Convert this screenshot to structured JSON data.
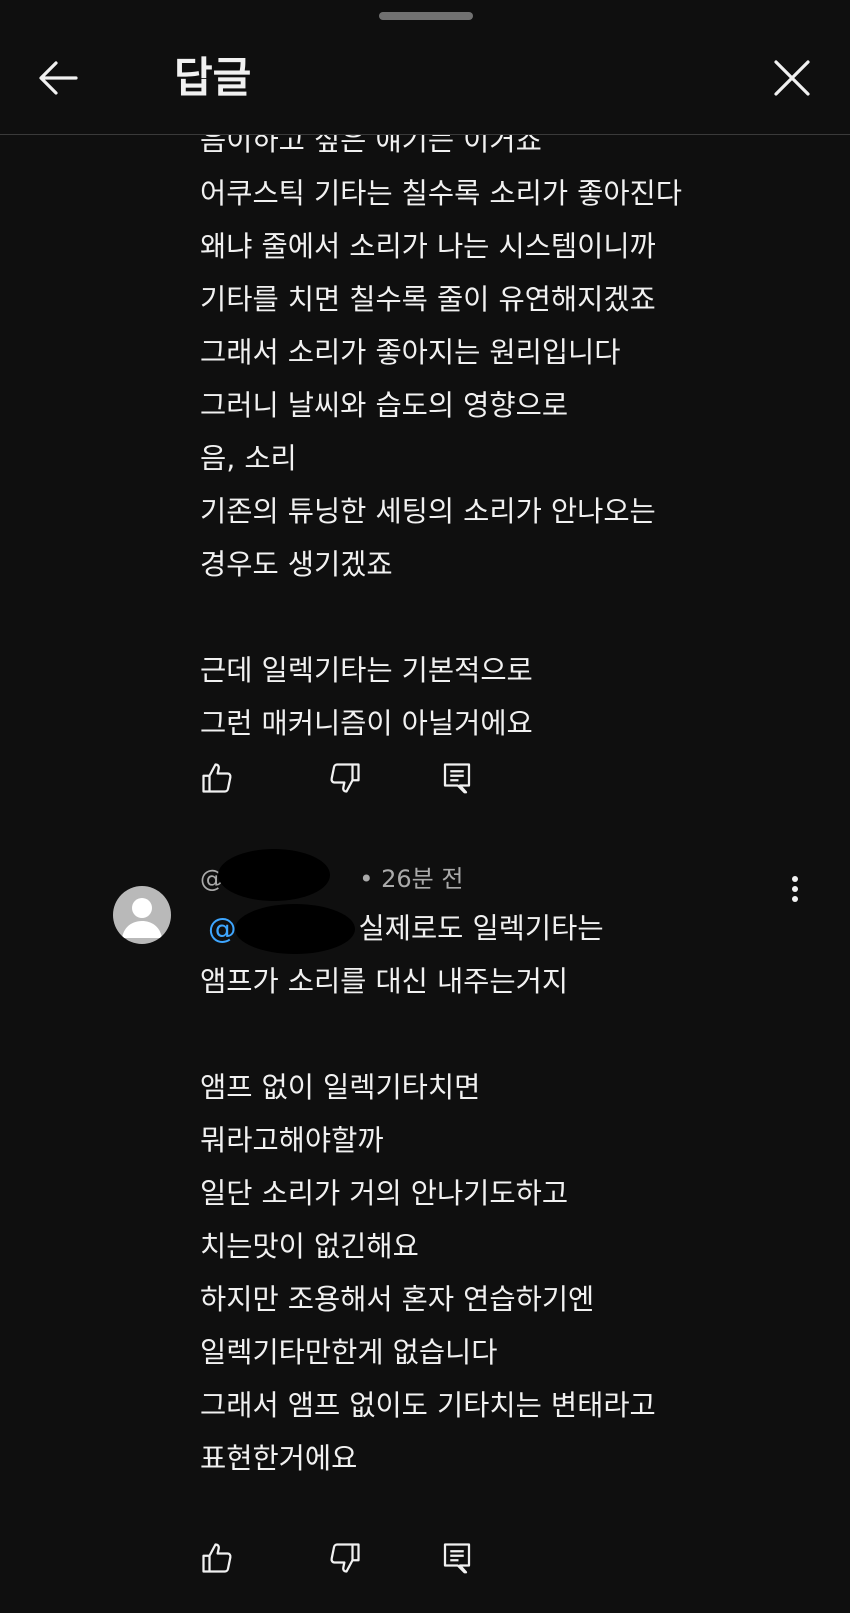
{
  "header": {
    "title": "답글",
    "back_icon": "arrow-left-icon",
    "close_icon": "close-icon"
  },
  "comment1": {
    "partial_line": "음이하고 싶은 얘기는 이거죠",
    "lines": [
      "어쿠스틱 기타는 칠수록 소리가 좋아진다",
      "왜냐 줄에서 소리가 나는 시스템이니까",
      "기타를 치면 칠수록 줄이 유연해지겠죠",
      "그래서 소리가 좋아지는 원리입니다",
      "그러니 날씨와 습도의 영향으로",
      "음, 소리",
      "기존의 튜닝한 세팅의 소리가 안나오는",
      "경우도 생기겠죠",
      "",
      "근데 일렉기타는 기본적으로",
      "그런 매커니즘이 아닐거에요"
    ],
    "actions": {
      "like_icon": "thumbs-up-icon",
      "dislike_icon": "thumbs-down-icon",
      "reply_icon": "reply-comment-icon"
    }
  },
  "comment2": {
    "author_prefix": "@",
    "time": "• 26분 전",
    "mention_prefix": "@",
    "first_line_text": "실제로도 일렉기타는",
    "lines": [
      "앰프가 소리를 대신 내주는거지",
      "",
      "앰프 없이 일렉기타치면",
      "뭐라고해야할까",
      "일단 소리가 거의 안나기도하고",
      "치는맛이 없긴해요",
      "하지만 조용해서 혼자 연습하기엔",
      "일렉기타만한게 없습니다",
      "그래서 앰프 없이도 기타치는 변태라고",
      "표현한거에요"
    ],
    "actions": {
      "like_icon": "thumbs-up-icon",
      "dislike_icon": "thumbs-down-icon",
      "reply_icon": "reply-comment-icon"
    },
    "more_icon": "more-vertical-icon",
    "avatar_icon": "default-avatar-icon"
  },
  "colors": {
    "background": "#0f0f0f",
    "text": "#f1f1f1",
    "meta": "#aaaaaa",
    "mention": "#3ea6ff"
  }
}
